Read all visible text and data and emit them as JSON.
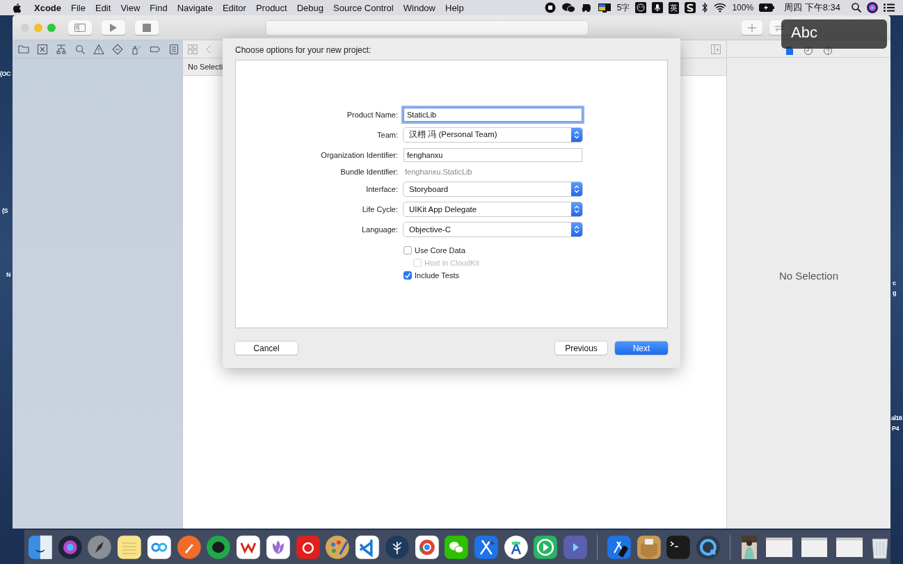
{
  "menu_bar": {
    "app_name": "Xcode",
    "menus": [
      "File",
      "Edit",
      "View",
      "Find",
      "Navigate",
      "Editor",
      "Product",
      "Debug",
      "Source Control",
      "Window",
      "Help"
    ],
    "ime_count": "5字",
    "ime_language": "英",
    "battery": "100%",
    "clock": "周四 下午8:34"
  },
  "desktop_labels": [
    "(OC",
    "(S",
    "N",
    "c",
    "g",
    "al16",
    "P4"
  ],
  "editor": {
    "jump_bar_text": "No Selecti"
  },
  "inspector": {
    "message": "No Selection"
  },
  "input_hud": {
    "text": "Abc"
  },
  "dialog": {
    "title": "Choose options for your new project:",
    "fields": [
      {
        "kind": "text",
        "label": "Product Name:",
        "value": "StaticLib",
        "focused": true
      },
      {
        "kind": "popup",
        "label": "Team:",
        "value": "汉栩 冯 (Personal Team)"
      },
      {
        "kind": "text",
        "label": "Organization Identifier:",
        "value": "fenghanxu",
        "focused": false
      },
      {
        "kind": "static",
        "label": "Bundle Identifier:",
        "value": "fenghanxu.StaticLib"
      },
      {
        "kind": "popup",
        "label": "Interface:",
        "value": "Storyboard"
      },
      {
        "kind": "popup",
        "label": "Life Cycle:",
        "value": "UIKit App Delegate"
      },
      {
        "kind": "popup",
        "label": "Language:",
        "value": "Objective-C"
      }
    ],
    "checkboxes": [
      {
        "label": "Use Core Data",
        "checked": false,
        "disabled": false,
        "children": [
          {
            "label": "Host in CloudKit",
            "checked": false,
            "disabled": true
          }
        ]
      },
      {
        "label": "Include Tests",
        "checked": true,
        "disabled": false
      }
    ],
    "left_buttons": [
      {
        "label": "Cancel",
        "default": false
      }
    ],
    "right_buttons": [
      {
        "label": "Previous",
        "default": false
      },
      {
        "label": "Next",
        "default": true
      }
    ]
  }
}
